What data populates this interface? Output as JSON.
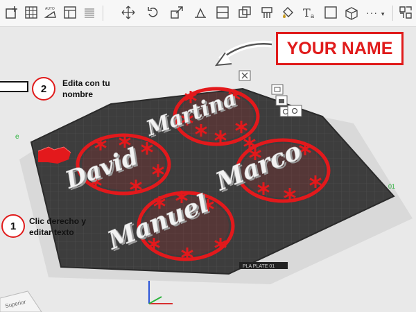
{
  "toolbar": {
    "tools": [
      "add-object-icon",
      "arrange-grid-icon",
      "auto-orient-icon",
      "plate-layout-icon",
      "layer-list-icon",
      "move-icon",
      "rotate-icon",
      "scale-icon",
      "place-face-icon",
      "cut-icon",
      "boolean-icon",
      "support-paint-icon",
      "paint-color-icon",
      "text-tool-icon",
      "box-primitive-icon",
      "more-icon",
      "assembly-icon"
    ],
    "more_label": "···"
  },
  "annotations": {
    "step2_number": "2",
    "step2_text_line1": "Edita con tu",
    "step2_text_line2": "nombre",
    "step1_number": "1",
    "step1_text_line1": "Clic derecho y",
    "step1_text_line2": "editar texto",
    "your_name": "YOUR NAME"
  },
  "plate": {
    "plate_label": "PLA PLATE 01",
    "plate_number_right": "01",
    "corner_label": "Superior",
    "axis_label": "e",
    "plate_buttons": [
      "close-icon",
      "arrange-plate-icon",
      "lock-icon",
      "settings-icon",
      "view-icon"
    ]
  },
  "ornaments": [
    {
      "name": "Martina"
    },
    {
      "name": "David"
    },
    {
      "name": "Marco"
    },
    {
      "name": "Manuel"
    }
  ],
  "colors": {
    "ornament_red": "#e3191c",
    "plate_dark": "#3d3d3d",
    "text_white": "#f2f2f2",
    "accent_red": "#e01b1b"
  }
}
